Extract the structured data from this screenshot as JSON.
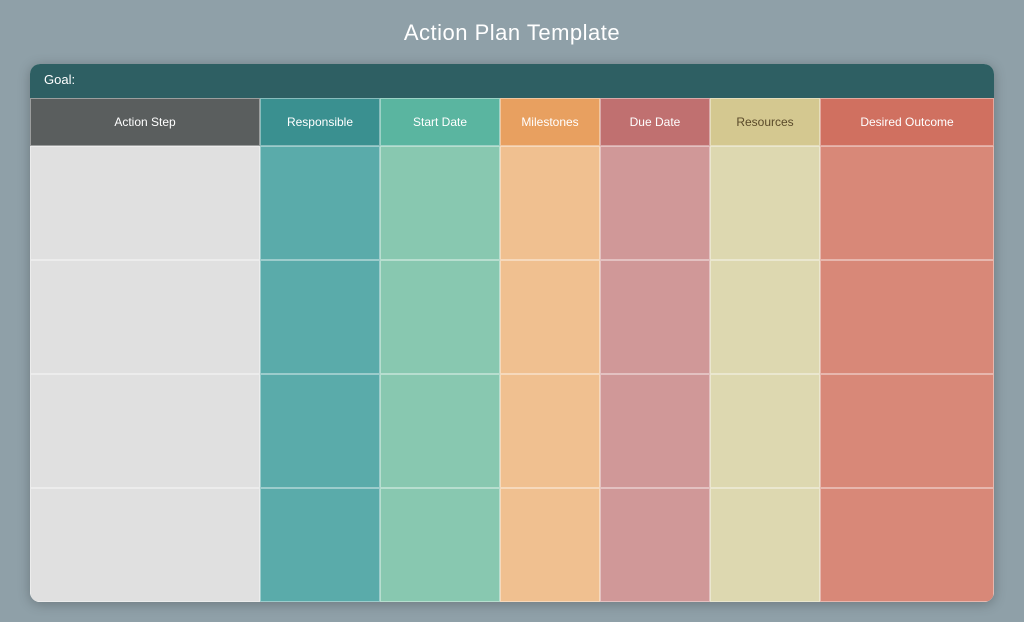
{
  "page": {
    "title": "Action Plan Template"
  },
  "goal_label": "Goal:",
  "columns": [
    {
      "key": "action",
      "label": "Action Step",
      "header_class": "header-action",
      "data_class": "data-action",
      "col_class": "col-action"
    },
    {
      "key": "resp",
      "label": "Responsible",
      "header_class": "header-resp",
      "data_class": "data-resp",
      "col_class": "col-resp"
    },
    {
      "key": "start",
      "label": "Start Date",
      "header_class": "header-start",
      "data_class": "data-start",
      "col_class": "col-start"
    },
    {
      "key": "mile",
      "label": "Milestones",
      "header_class": "header-mile",
      "data_class": "data-mile",
      "col_class": "col-mile"
    },
    {
      "key": "due",
      "label": "Due Date",
      "header_class": "header-due",
      "data_class": "data-due",
      "col_class": "col-due"
    },
    {
      "key": "res",
      "label": "Resources",
      "header_class": "header-res",
      "data_class": "data-res",
      "col_class": "col-res"
    },
    {
      "key": "desired",
      "label": "Desired Outcome",
      "header_class": "header-desired",
      "data_class": "data-desired",
      "col_class": "col-desired"
    }
  ],
  "row_count": 4
}
